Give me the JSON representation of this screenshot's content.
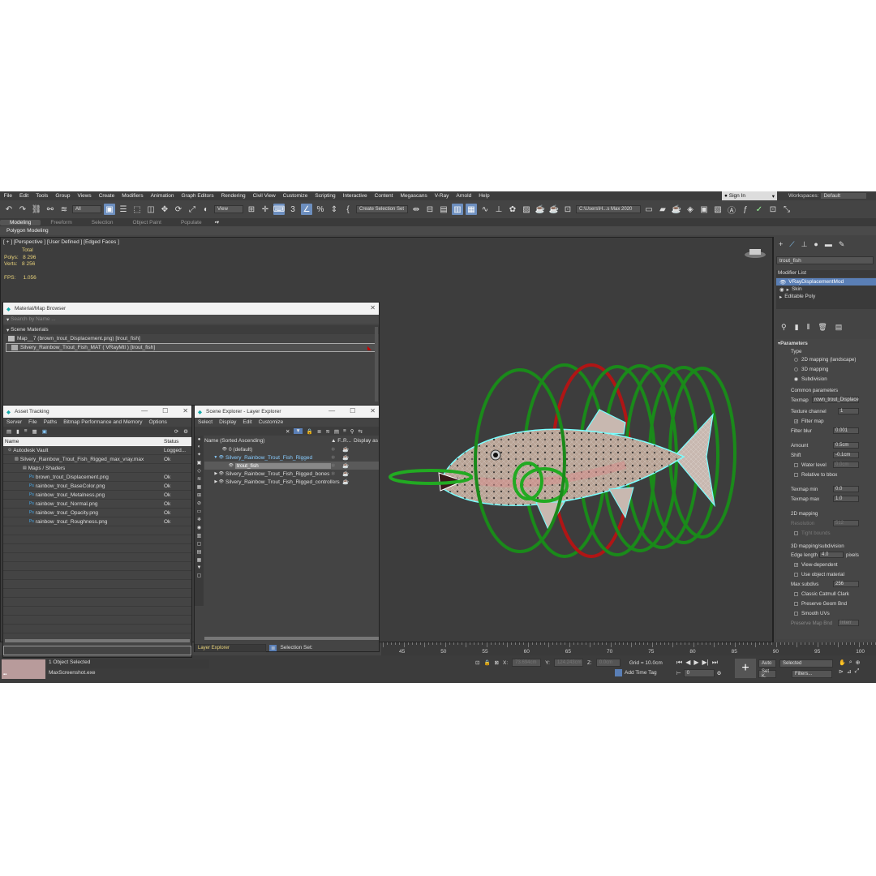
{
  "menubar": {
    "items": [
      "File",
      "Edit",
      "Tools",
      "Group",
      "Views",
      "Create",
      "Modifiers",
      "Animation",
      "Graph Editors",
      "Rendering",
      "Civil View",
      "Customize",
      "Scripting",
      "Interactive",
      "Content",
      "Megascans",
      "V-Ray",
      "Arnold",
      "Help"
    ],
    "signin": "Sign In",
    "workspaces_label": "Workspaces:",
    "workspaces_value": "Default"
  },
  "toolbar": {
    "filter": "All",
    "refcoord": "View",
    "selection_set": "Create Selection Set",
    "path": "C:\\Users\\H...s Max 2020"
  },
  "ribbon": {
    "tabs": [
      "Modeling",
      "Freeform",
      "Selection",
      "Object Paint",
      "Populate"
    ],
    "sub": "Polygon Modeling"
  },
  "viewport": {
    "label": "[ + ] [Perspective ] [User Defined ] [Edged Faces ]",
    "stats_total": "Total",
    "polys_label": "Polys:",
    "polys": "8 296",
    "verts_label": "Verts:",
    "verts": "8 256",
    "fps_label": "FPS:",
    "fps": "1.056"
  },
  "material_browser": {
    "title": "Material/Map Browser",
    "search": "Search by Name ...",
    "section": "Scene Materials",
    "rows": [
      "Map__7 (brown_trout_Displacement.png)  [trout_fish]",
      "Silvery_Rainbow_Trout_Fish_MAT  ( VRayMtl )  [trout_fish]"
    ]
  },
  "asset_tracking": {
    "title": "Asset Tracking",
    "menu": [
      "Server",
      "File",
      "Paths",
      "Bitmap Performance and Memory",
      "Options"
    ],
    "col_name": "Name",
    "col_status": "Status",
    "rows": [
      {
        "name": "Autodesk Vault",
        "status": "Logged..."
      },
      {
        "name": "Silvery_Rainbow_Trout_Fish_Rigged_max_vray.max",
        "status": "Ok"
      },
      {
        "name": "Maps / Shaders",
        "status": ""
      },
      {
        "name": "brown_trout_Displacement.png",
        "status": "Ok"
      },
      {
        "name": "rainbow_trout_BaseColor.png",
        "status": "Ok"
      },
      {
        "name": "rainbow_trout_Metalness.png",
        "status": "Ok"
      },
      {
        "name": "rainbow_trout_Normal.png",
        "status": "Ok"
      },
      {
        "name": "rainbow_trout_Opacity.png",
        "status": "Ok"
      },
      {
        "name": "rainbow_trout_Roughness.png",
        "status": "Ok"
      }
    ]
  },
  "scene_explorer": {
    "title": "Scene Explorer - Layer Explorer",
    "menu": [
      "Select",
      "Display",
      "Edit",
      "Customize"
    ],
    "col_name": "Name (Sorted Ascending)",
    "col_f": "▲ F...",
    "col_r": "R...",
    "col_display": "Display as",
    "rows": [
      "0 (default)",
      "Silvery_Rainbow_Trout_Fish_Rigged",
      "trout_fish",
      "Silvery_Rainbow_Trout_Fish_Rigged_bones",
      "Silvery_Rainbow_Trout_Fish_Rigged_controllers"
    ],
    "footer_combo": "Layer Explorer",
    "footer_selset": "Selection Set:"
  },
  "command_panel": {
    "object_name": "trout_fish",
    "modifier_list": "Modifier List",
    "stack": [
      "VRayDisplacementMod",
      "Skin",
      "Editable Poly"
    ],
    "params_title": "Parameters",
    "type_label": "Type",
    "type_opts": [
      "2D mapping (landscape)",
      "3D mapping",
      "Subdivision"
    ],
    "common_label": "Common parameters",
    "texmap_label": "Texmap",
    "texmap_value": "rown_trout_Displace",
    "tex_channel_label": "Texture channel",
    "tex_channel": "1",
    "filter_map": "Filter map",
    "filter_blur_label": "Filter blur",
    "filter_blur": "0.001",
    "amount_label": "Amount",
    "amount": "0.5cm",
    "shift_label": "Shift",
    "shift": "-0.1cm",
    "water_level": "Water level",
    "water_level_val": "0.0cm",
    "relative_bbox": "Relative to bbox",
    "texmap_min_label": "Texmap min",
    "texmap_min": "0.0",
    "texmap_max_label": "Texmap max",
    "texmap_max": "1.0",
    "map2d_label": "2D mapping",
    "resolution_label": "Resolution",
    "resolution": "512",
    "tight_bounds": "Tight bounds",
    "map3d_label": "3D mapping/subdivision",
    "edge_len_label": "Edge length",
    "edge_len": "4.0",
    "pixels": "pixels",
    "view_dependent": "View-dependent",
    "use_obj_mat": "Use object material",
    "max_subdivs_label": "Max subdivs",
    "max_subdivs": "256",
    "classic_cc": "Classic Catmull Clark",
    "preserve_geom": "Preserve Geom Bnd",
    "smooth_uvs": "Smooth UVs",
    "preserve_map_bnd": "Preserve Map Bnd",
    "preserve_map_val": "Interr"
  },
  "timeline": {
    "ticks": [
      "45",
      "50",
      "55",
      "60",
      "65",
      "70",
      "75",
      "80",
      "85",
      "90",
      "95",
      "100"
    ]
  },
  "status": {
    "selected": "1 Object Selected",
    "app": "MaxScreenshot.exe",
    "x_label": "X:",
    "x": "73.694cm",
    "y_label": "Y:",
    "y": "124.243cm",
    "z_label": "Z:",
    "z": "0.0cm",
    "grid": "Grid = 10.0cm",
    "add_time_tag": "Add Time Tag",
    "frame": "0",
    "auto": "Auto",
    "set_k": "Set K.",
    "sel_combo": "Selected",
    "filters": "Filters..."
  }
}
